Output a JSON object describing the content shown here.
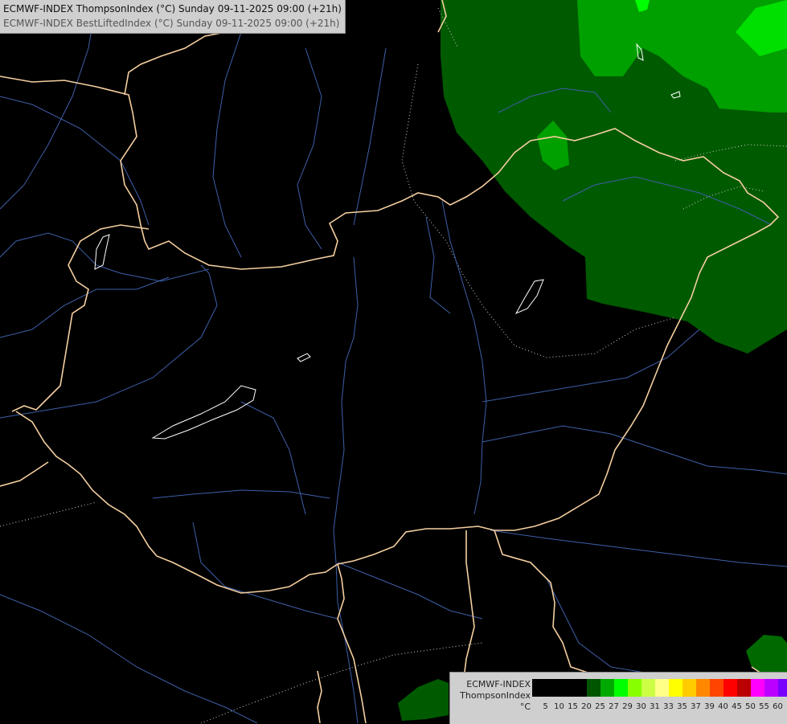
{
  "title": {
    "line1": "ECMWF-INDEX ThompsonIndex (°C) Sunday 09-11-2025 09:00 (+21h)",
    "line2": "ECMWF-INDEX BestLiftedIndex (°C) Sunday 09-11-2025 09:00 (+21h)"
  },
  "legend": {
    "line1": "ECMWF-INDEX",
    "line2": "ThompsonIndex",
    "unit": "°C",
    "levels": [
      "5",
      "10",
      "15",
      "20",
      "25",
      "27",
      "29",
      "30",
      "31",
      "33",
      "35",
      "37",
      "39",
      "40",
      "45",
      "50",
      "55",
      "60"
    ],
    "colors": [
      "#000000",
      "#000000",
      "#000000",
      "#000000",
      "#005500",
      "#00aa00",
      "#00ff00",
      "#88ff00",
      "#ccff44",
      "#ffff88",
      "#ffff00",
      "#ffcc00",
      "#ff8800",
      "#ff4400",
      "#ff0000",
      "#bb0000",
      "#ff00ff",
      "#bb00ff",
      "#7700ff",
      "#0000ff"
    ]
  },
  "colors": {
    "background": "#000000",
    "border": "#f5cfa0",
    "river": "#3e5fa8",
    "lake": "#ffffff",
    "contour": "#cfcfcf",
    "fill_25": "#005500",
    "fill_27": "#00aa00",
    "fill_29": "#00ff00"
  }
}
